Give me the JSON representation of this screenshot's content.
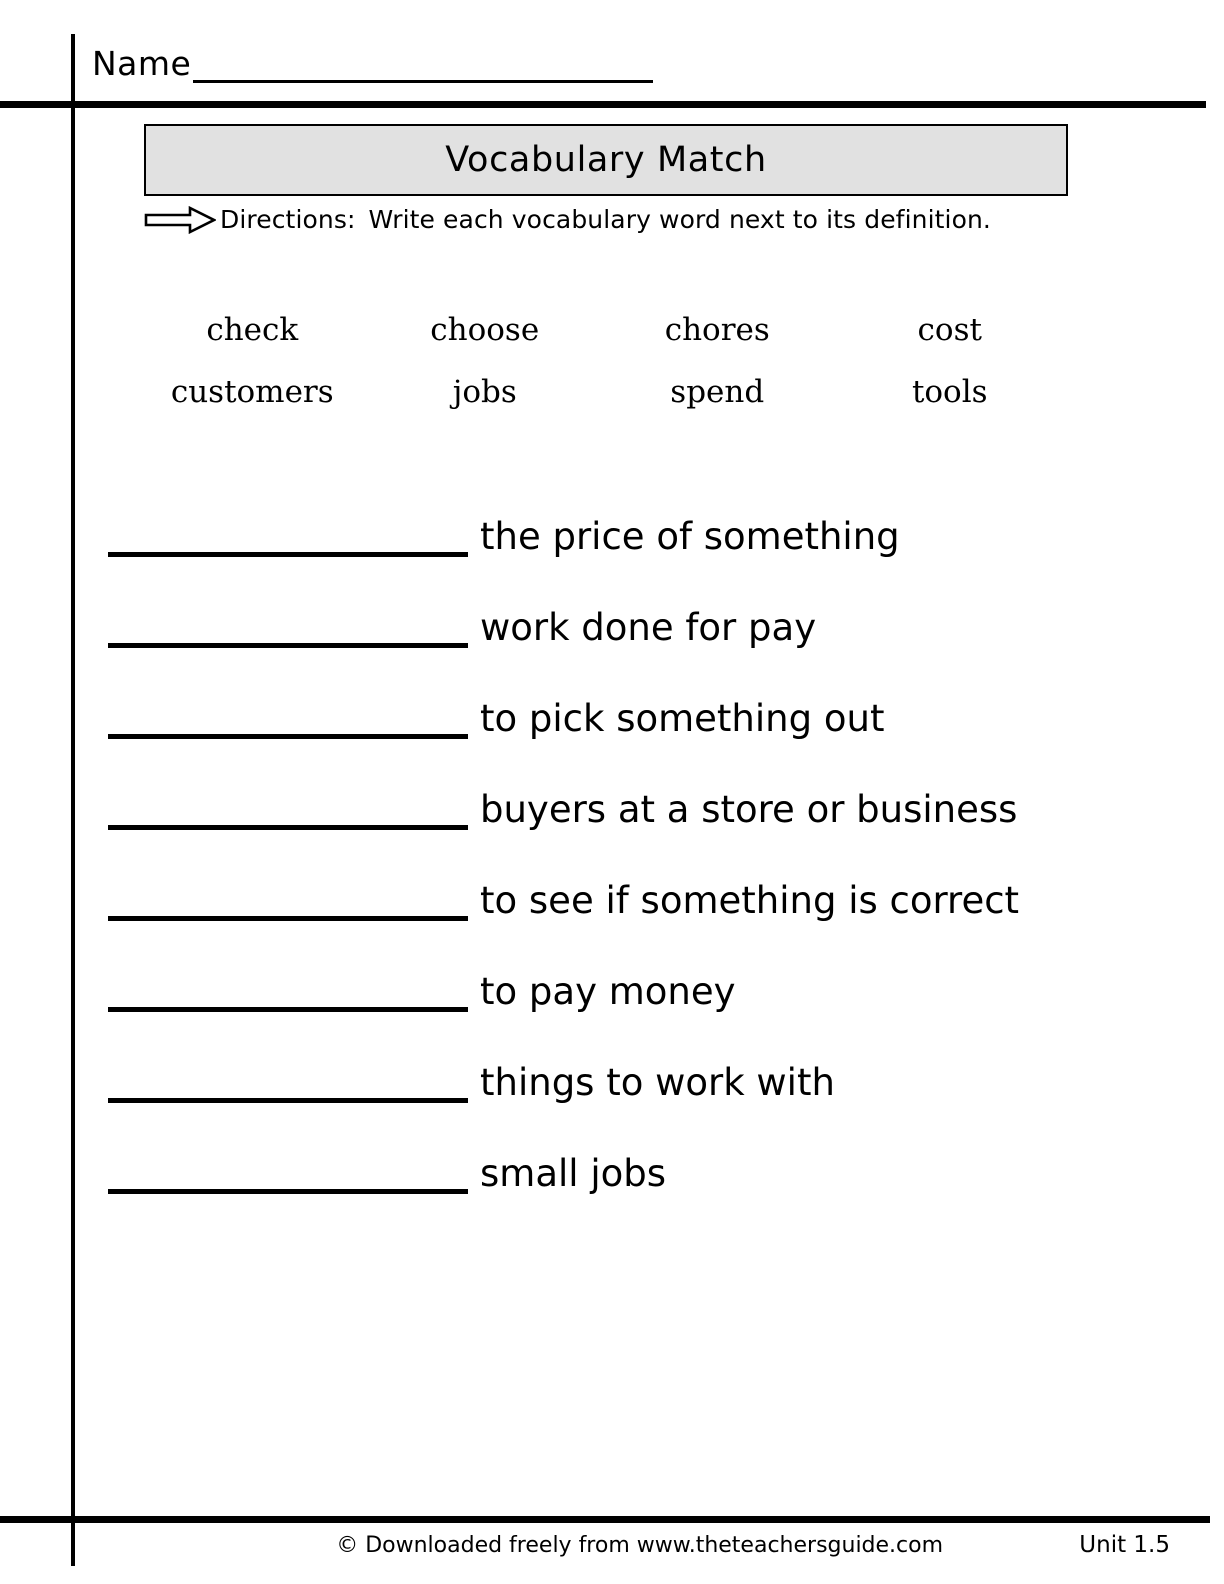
{
  "header": {
    "name_label": "Name",
    "name_value": ""
  },
  "title": {
    "text": "Vocabulary Match"
  },
  "directions": {
    "icon": "right-arrow-icon",
    "label": "Directions:",
    "text": "Write each vocabulary word next to its definition."
  },
  "word_bank": {
    "rows": [
      [
        "check",
        "choose",
        "chores",
        "cost"
      ],
      [
        "customers",
        "jobs",
        "spend",
        "tools"
      ]
    ]
  },
  "definitions": [
    {
      "answer": "",
      "text": "the price of something"
    },
    {
      "answer": "",
      "text": "work done for pay"
    },
    {
      "answer": "",
      "text": "to pick something out"
    },
    {
      "answer": "",
      "text": "buyers at a store or business"
    },
    {
      "answer": "",
      "text": "to see if something is correct"
    },
    {
      "answer": "",
      "text": "to pay money"
    },
    {
      "answer": "",
      "text": "things to work with"
    },
    {
      "answer": "",
      "text": "small jobs"
    }
  ],
  "footer": {
    "credit": "© Downloaded freely from www.theteachersguide.com",
    "unit": "Unit 1.5"
  },
  "colors": {
    "ink": "#000000",
    "title_box_fill": "#e1e1e1",
    "paper": "#ffffff"
  }
}
